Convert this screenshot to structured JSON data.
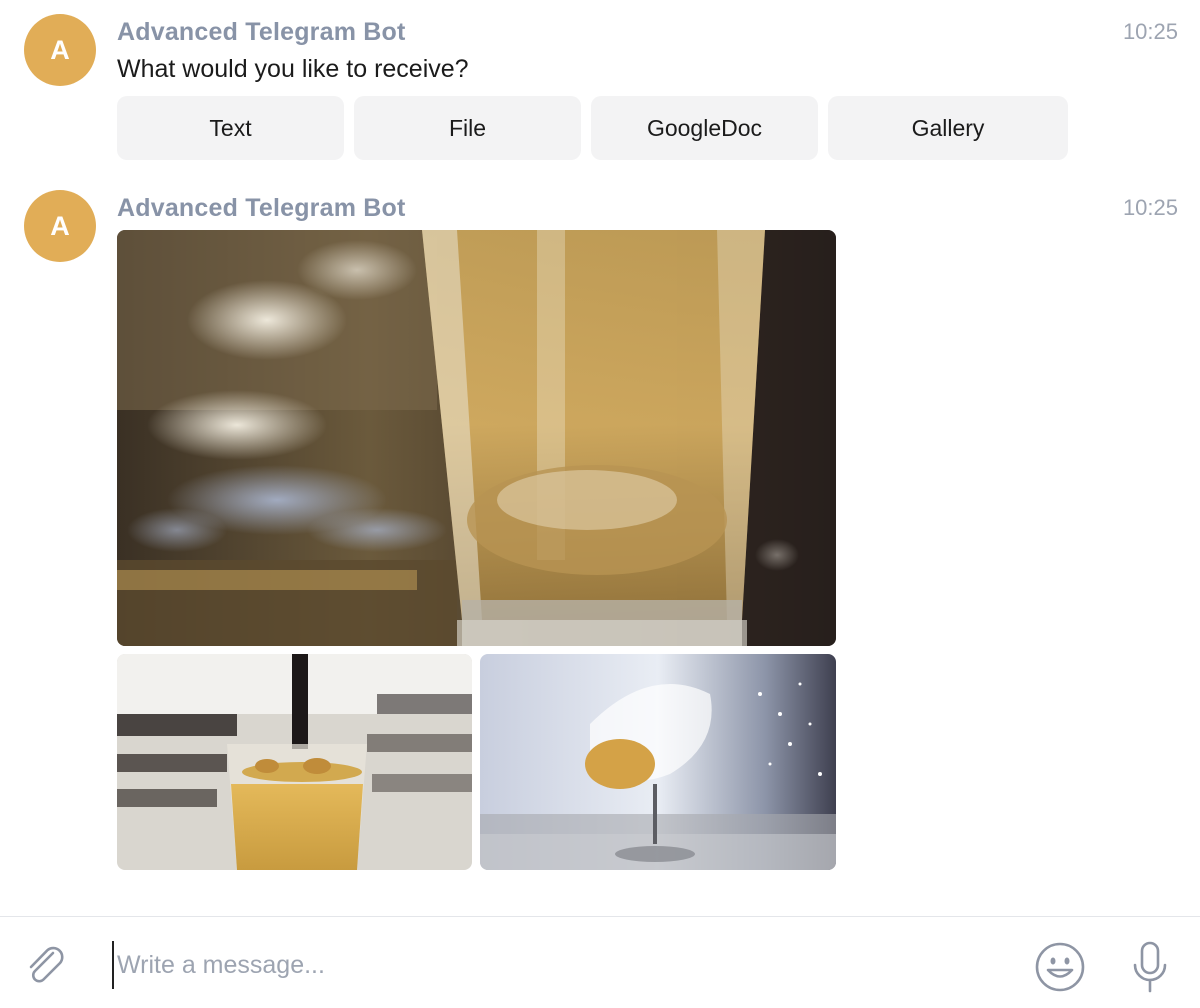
{
  "messages": [
    {
      "avatar_letter": "A",
      "sender": "Advanced Telegram Bot",
      "time": "10:25",
      "text": "What would you like to receive?",
      "buttons": [
        "Text",
        "File",
        "GoogleDoc",
        "Gallery"
      ]
    },
    {
      "avatar_letter": "A",
      "sender": "Advanced Telegram Bot",
      "time": "10:25",
      "gallery": [
        {
          "subject": "glass-of-beer-on-bar"
        },
        {
          "subject": "juice-glass-with-straw"
        },
        {
          "subject": "splashing-wine-glass"
        }
      ]
    }
  ],
  "composer": {
    "placeholder": "Write a message...",
    "icons": [
      "paperclip-icon",
      "emoji-icon",
      "microphone-icon"
    ]
  },
  "colors": {
    "avatar": "#e1ad57",
    "sender": "#8893a7",
    "time": "#9da4b1",
    "button_bg": "#f3f3f4"
  }
}
